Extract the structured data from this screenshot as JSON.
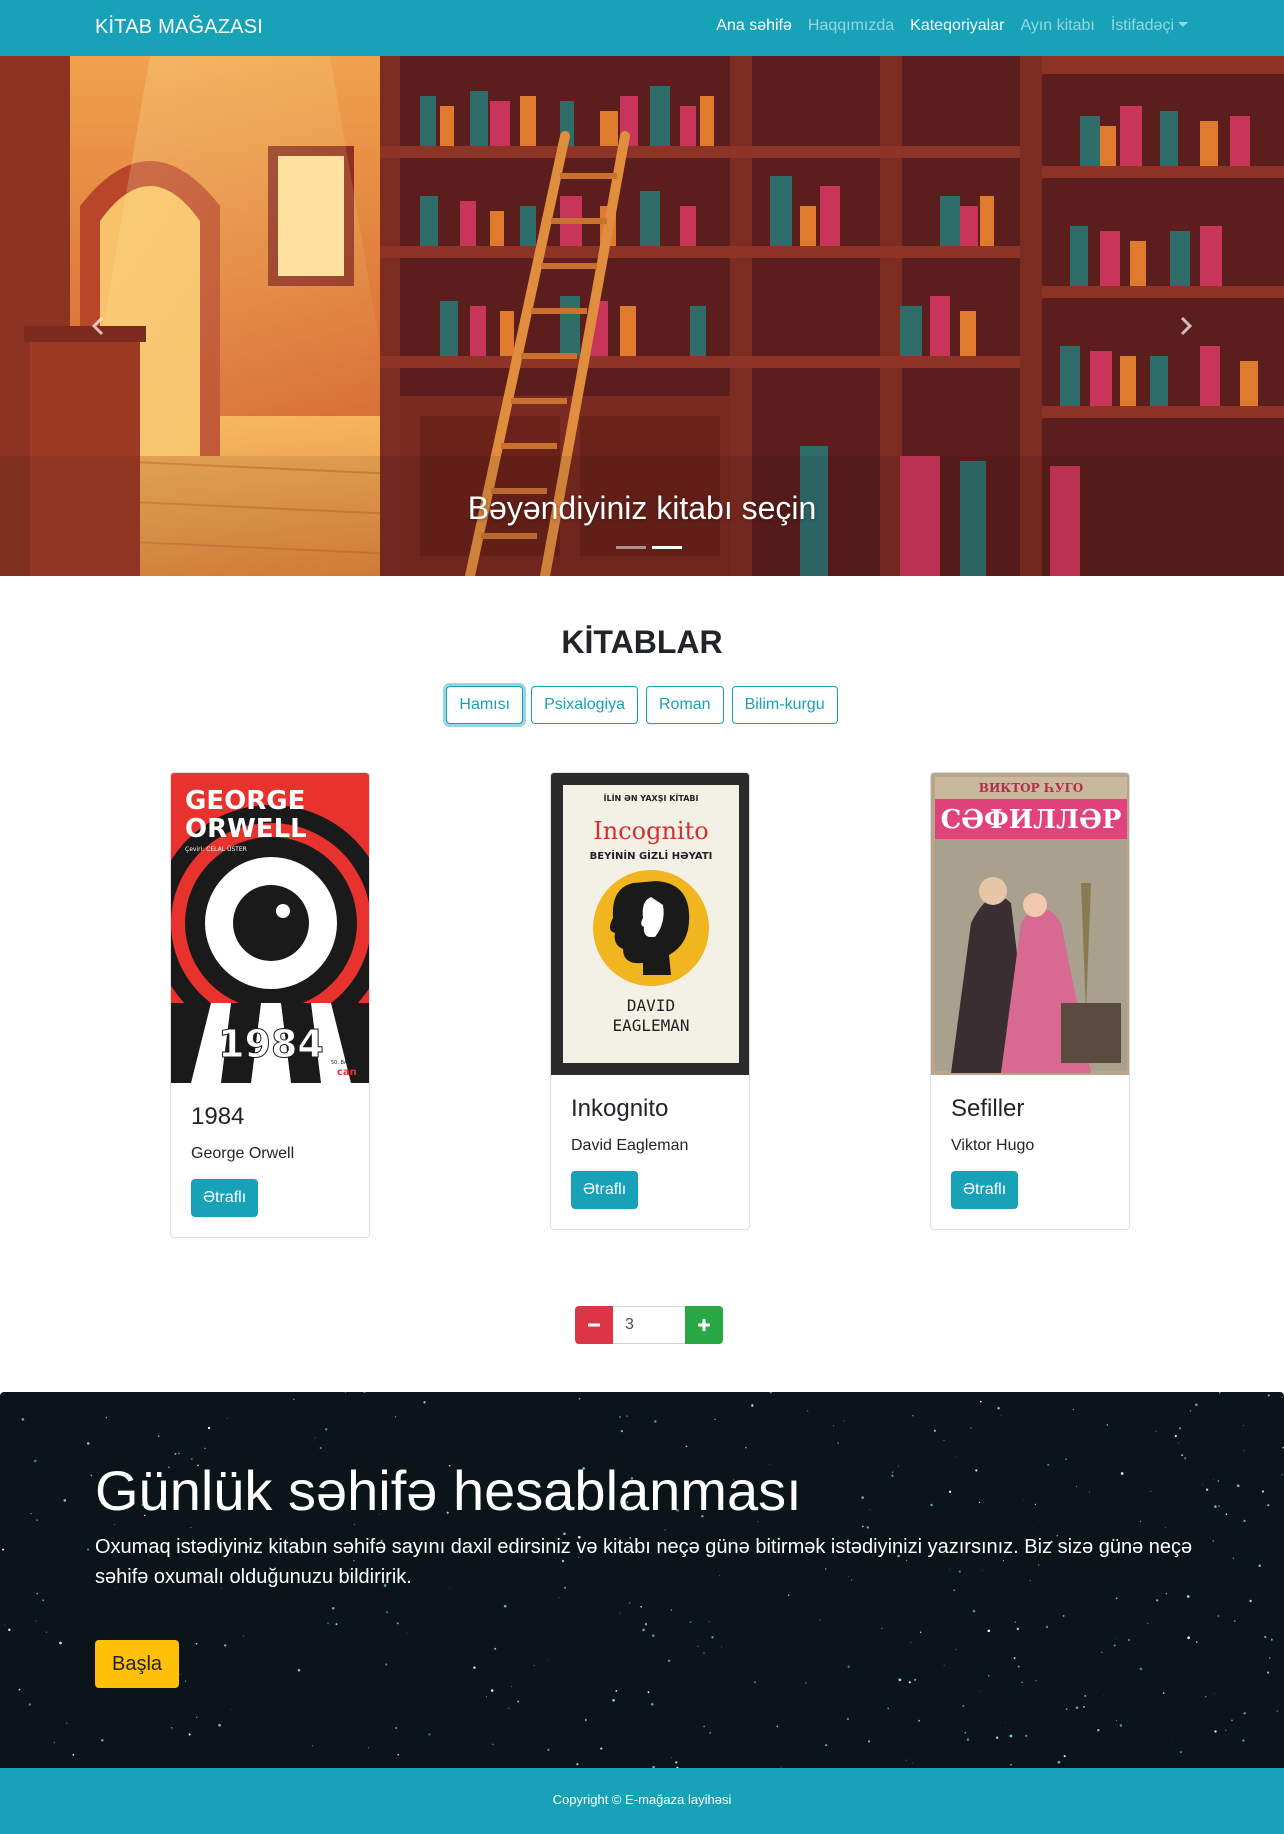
{
  "navbar": {
    "brand": "KİTAB MAĞAZASI",
    "links": [
      "Ana səhifə",
      "Haqqımızda",
      "Kateqoriyalar",
      "Ayın kitabı",
      "İstifadəçi"
    ]
  },
  "carousel": {
    "caption": "Bəyəndiyiniz kitabı seçin",
    "prev_icon": "chevron-left-icon",
    "next_icon": "chevron-right-icon",
    "slides": 2,
    "active_slide": 2
  },
  "books": {
    "title": "KİTABLAR",
    "filters": [
      "Hamısı",
      "Psixalogiya",
      "Roman",
      "Bilim-kurgu"
    ],
    "active_filter": "Hamısı",
    "items": [
      {
        "title": "1984",
        "author": "George Orwell",
        "button": "Ətraflı",
        "cover": {
          "line1": "GEORGE",
          "line2": "ORWELL",
          "small": "Çeviri: CELAL ÜSTER",
          "bottom": "1984",
          "edition": "50. BASKI",
          "publisher": "can"
        }
      },
      {
        "title": "Inkognito",
        "author": "David Eagleman",
        "button": "Ətraflı",
        "cover": {
          "top": "İLİN ƏN YAXŞI KİTABI",
          "title": "Incognito",
          "subtitle": "BEYİNİN GİZLİ HƏYATI",
          "author1": "DAVID",
          "author2": "EAGLEMAN"
        }
      },
      {
        "title": "Sefiller",
        "author": "Viktor Hugo",
        "button": "Ətraflı",
        "cover": {
          "top": "ВИКТОР ҺУГО",
          "title": "СӘФИЛЛӘР"
        }
      }
    ]
  },
  "stepper": {
    "value": "3",
    "minus_icon": "minus-icon",
    "plus_icon": "plus-icon"
  },
  "jumbotron": {
    "title": "Günlük səhifə hesablanması",
    "text": "Oxumaq istədiyiniz kitabın səhifə sayını daxil edirsiniz və kitabı neçə günə bitirmək istədiyinizi yazırsınız. Biz sizə günə neçə səhifə oxumalı olduğunuzu bildiririk.",
    "button": "Başla"
  },
  "footer": {
    "text": "Copyright © E-mağaza layihəsi"
  },
  "colors": {
    "primary": "#17a2b8",
    "danger": "#dc3545",
    "success": "#28a745",
    "warning": "#ffc107"
  }
}
